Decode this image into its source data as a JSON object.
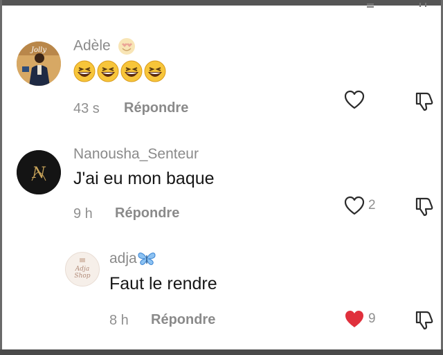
{
  "comments": [
    {
      "author": "Adèle",
      "author_emoji": "heart-eyes-emoji",
      "text_emojis": [
        "laughing-emoji",
        "laughing-emoji",
        "laughing-emoji",
        "laughing-emoji"
      ],
      "time": "43 s",
      "reply_label": "Répondre",
      "likes": "",
      "liked": false
    },
    {
      "author": "Nanousha_Senteur",
      "text": "J'ai eu mon baque",
      "time": "9 h",
      "reply_label": "Répondre",
      "likes": "2",
      "liked": false
    },
    {
      "author": "adja",
      "author_emoji": "butterfly-emoji",
      "text": "Faut le rendre",
      "time": "8 h",
      "reply_label": "Répondre",
      "likes": "9",
      "liked": true,
      "avatar_text": "Adja Shop"
    }
  ],
  "colors": {
    "liked_heart": "#e0303c",
    "meta_gray": "#8f8f8f",
    "text": "#161616"
  }
}
